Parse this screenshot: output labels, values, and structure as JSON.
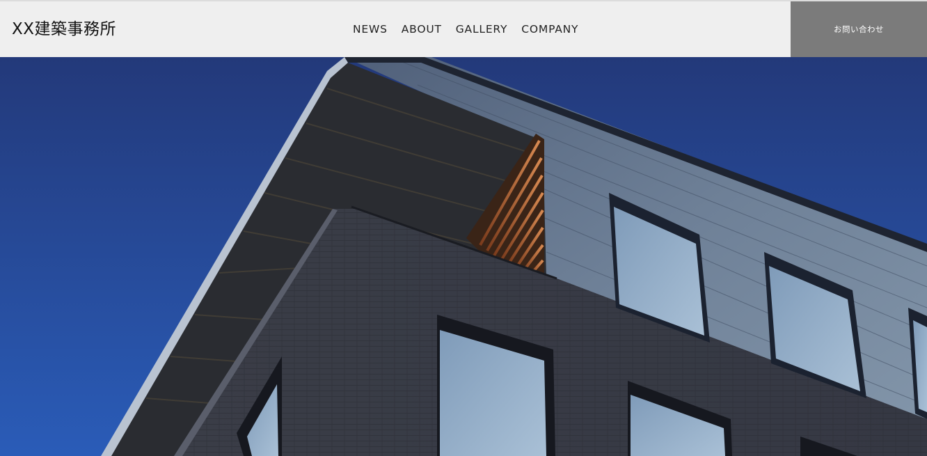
{
  "header": {
    "logo": "XX建築事務所",
    "nav": [
      "NEWS",
      "ABOUT",
      "GALLERY",
      "COMPANY"
    ],
    "contact_label": "お問い合わせ"
  },
  "hero": {
    "image_subject": "modern-building-corner-against-blue-sky"
  },
  "colors": {
    "header_bg": "#efefef",
    "contact_bg": "#7b7b7b",
    "sky_top": "#23397a",
    "sky_bottom": "#2a5cb8"
  }
}
